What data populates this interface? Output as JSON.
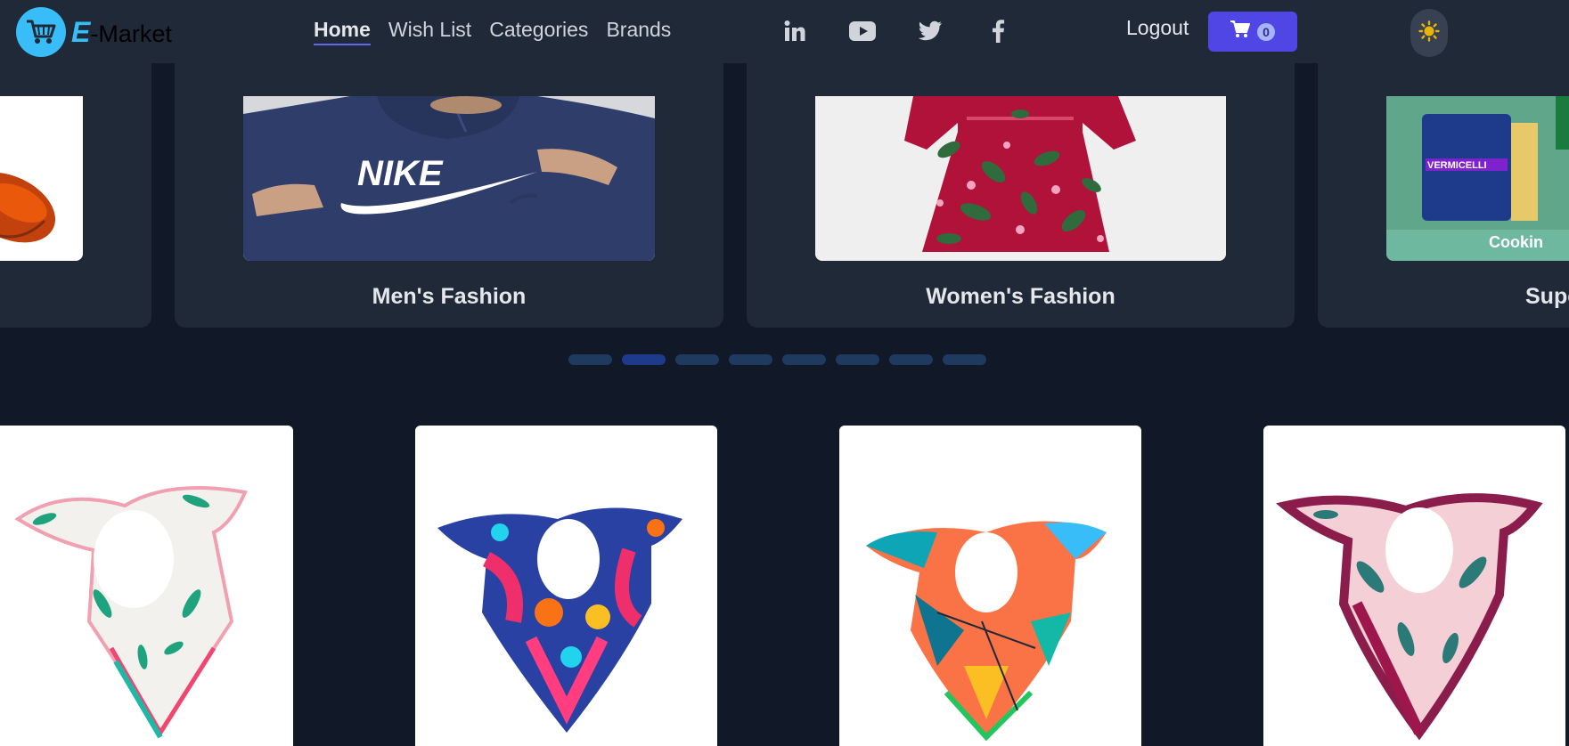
{
  "brand": {
    "prefix": "E",
    "name": "-Market"
  },
  "nav": {
    "links": [
      {
        "label": "Home"
      },
      {
        "label": "Wish List"
      },
      {
        "label": "Categories"
      },
      {
        "label": "Brands"
      }
    ],
    "logout_label": "Logout",
    "cart_count": "0"
  },
  "socials": [
    "linkedin-icon",
    "youtube-icon",
    "twitter-icon",
    "facebook-icon"
  ],
  "categories": [
    {
      "label": ""
    },
    {
      "label": "Men's Fashion"
    },
    {
      "label": "Women's Fashion"
    },
    {
      "label": "Supe"
    }
  ],
  "category_partial_product_text": "Cookin",
  "category_partial_product_brand": "VERMICELLI",
  "nike_logo_text": "NIKE",
  "slider": {
    "dot_count": 8,
    "active_index": 1
  },
  "products": [
    {
      "image": "scarf-white-floral"
    },
    {
      "image": "scarf-blue-pink"
    },
    {
      "image": "scarf-orange-teal"
    },
    {
      "image": "scarf-burgundy-pink"
    }
  ],
  "colors": {
    "navbar_bg": "#1f2937",
    "page_bg": "#111827",
    "accent": "#4f46e5",
    "logo_blue": "#38bdf8",
    "theme_icon": "#eab308"
  }
}
